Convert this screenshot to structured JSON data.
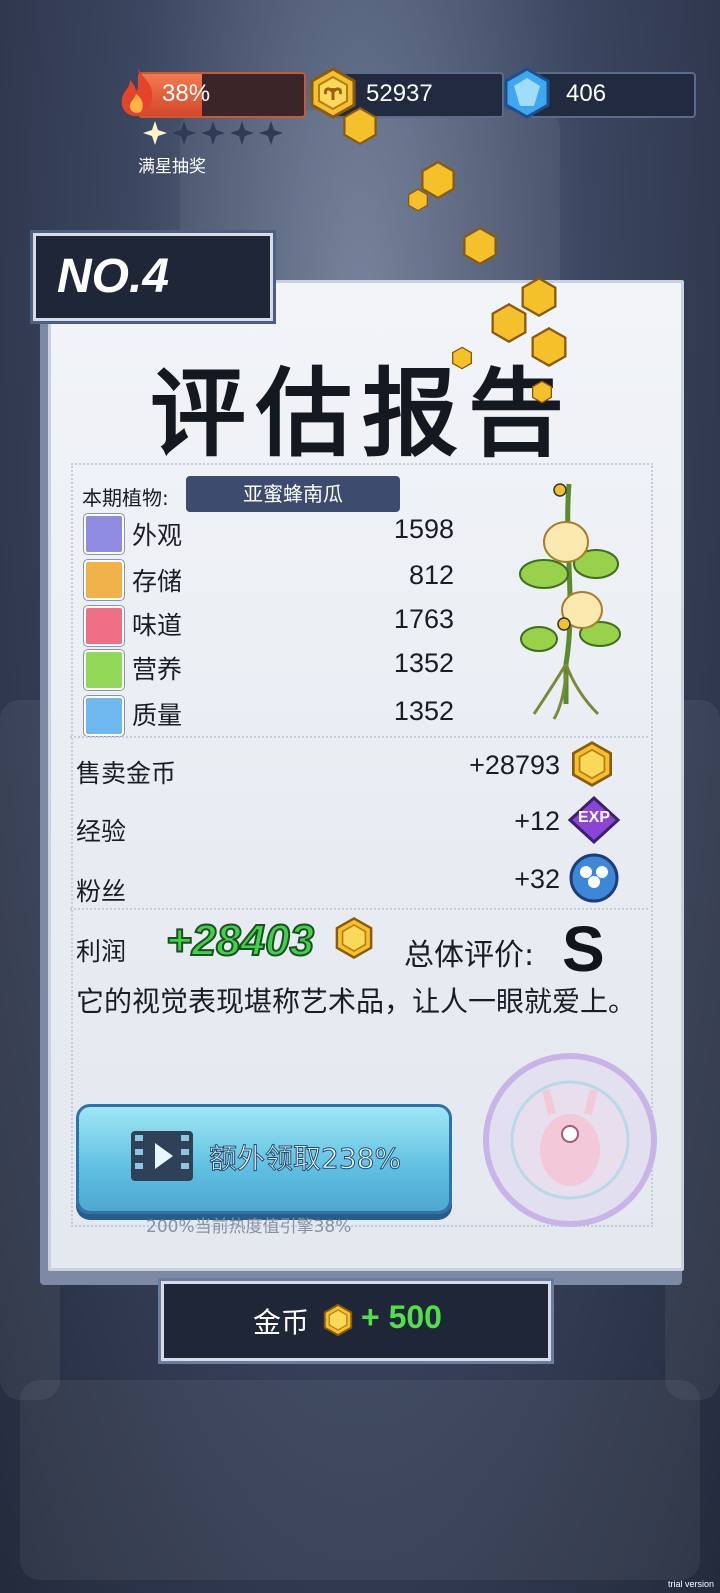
{
  "hud": {
    "heat_percent_text": "38%",
    "heat_progress": 0.38,
    "coins": "52937",
    "gems": "406",
    "stars_filled": 1,
    "stars_total": 5,
    "stars_label": "满星抽奖"
  },
  "report": {
    "number": "NO.4",
    "title": "评估报告",
    "plant_label": "本期植物:",
    "plant_name": "亚蜜蜂南瓜",
    "attributes": [
      {
        "label": "外观",
        "value": "1598",
        "icon": "sparkle-icon",
        "color": "#8e8be0"
      },
      {
        "label": "存储",
        "value": "812",
        "icon": "box-icon",
        "color": "#f2b24a"
      },
      {
        "label": "味道",
        "value": "1763",
        "icon": "utensils-icon",
        "color": "#ef6f87"
      },
      {
        "label": "营养",
        "value": "1352",
        "icon": "fruit-icon",
        "color": "#94d85a"
      },
      {
        "label": "质量",
        "value": "1352",
        "icon": "muscle-icon",
        "color": "#6fb8ef"
      }
    ],
    "sell_label": "售卖金币",
    "sell_value": "+28793",
    "exp_label": "经验",
    "exp_value": "+12",
    "exp_badge": "EXP",
    "fans_label": "粉丝",
    "fans_value": "+32",
    "profit_label": "利润",
    "profit_value": "+28403",
    "overall_label": "总体评价:",
    "overall_grade": "S",
    "description": "它的视觉表现堪称艺术品，让人一眼就爱上。",
    "claim_button": "额外领取238%",
    "claim_note": "200%当前热度值引擎38%",
    "stamp_text": "INTERSTELLAR NEWS"
  },
  "bottom": {
    "label": "金币",
    "amount": "+ 500"
  },
  "watermark": "trial version"
}
